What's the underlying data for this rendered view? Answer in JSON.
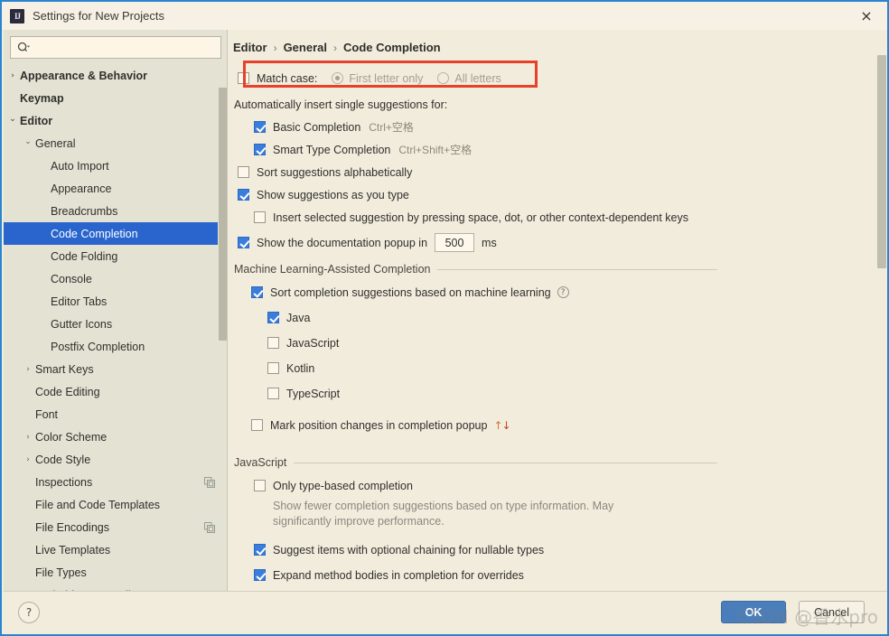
{
  "window": {
    "title": "Settings for New Projects",
    "app_icon": "intellij-idea-icon",
    "close_label": "×"
  },
  "search": {
    "value": "",
    "placeholder": "",
    "icon": "search-icon"
  },
  "sidebar": {
    "items": [
      {
        "label": "Appearance & Behavior",
        "indent": 0,
        "arrow": "›",
        "bold": true,
        "selected": false,
        "trailing_icon": null
      },
      {
        "label": "Keymap",
        "indent": 0,
        "arrow": "",
        "bold": true,
        "selected": false,
        "trailing_icon": null
      },
      {
        "label": "Editor",
        "indent": 0,
        "arrow": "⌄",
        "bold": true,
        "selected": false,
        "trailing_icon": null
      },
      {
        "label": "General",
        "indent": 1,
        "arrow": "⌄",
        "bold": false,
        "selected": false,
        "trailing_icon": null
      },
      {
        "label": "Auto Import",
        "indent": 2,
        "arrow": "",
        "bold": false,
        "selected": false,
        "trailing_icon": null
      },
      {
        "label": "Appearance",
        "indent": 2,
        "arrow": "",
        "bold": false,
        "selected": false,
        "trailing_icon": null
      },
      {
        "label": "Breadcrumbs",
        "indent": 2,
        "arrow": "",
        "bold": false,
        "selected": false,
        "trailing_icon": null
      },
      {
        "label": "Code Completion",
        "indent": 2,
        "arrow": "",
        "bold": false,
        "selected": true,
        "trailing_icon": null
      },
      {
        "label": "Code Folding",
        "indent": 2,
        "arrow": "",
        "bold": false,
        "selected": false,
        "trailing_icon": null
      },
      {
        "label": "Console",
        "indent": 2,
        "arrow": "",
        "bold": false,
        "selected": false,
        "trailing_icon": null
      },
      {
        "label": "Editor Tabs",
        "indent": 2,
        "arrow": "",
        "bold": false,
        "selected": false,
        "trailing_icon": null
      },
      {
        "label": "Gutter Icons",
        "indent": 2,
        "arrow": "",
        "bold": false,
        "selected": false,
        "trailing_icon": null
      },
      {
        "label": "Postfix Completion",
        "indent": 2,
        "arrow": "",
        "bold": false,
        "selected": false,
        "trailing_icon": null
      },
      {
        "label": "Smart Keys",
        "indent": 1,
        "arrow": "›",
        "bold": false,
        "selected": false,
        "trailing_icon": null
      },
      {
        "label": "Code Editing",
        "indent": 1,
        "arrow": "",
        "bold": false,
        "selected": false,
        "trailing_icon": null
      },
      {
        "label": "Font",
        "indent": 1,
        "arrow": "",
        "bold": false,
        "selected": false,
        "trailing_icon": null
      },
      {
        "label": "Color Scheme",
        "indent": 1,
        "arrow": "›",
        "bold": false,
        "selected": false,
        "trailing_icon": null
      },
      {
        "label": "Code Style",
        "indent": 1,
        "arrow": "›",
        "bold": false,
        "selected": false,
        "trailing_icon": null
      },
      {
        "label": "Inspections",
        "indent": 1,
        "arrow": "",
        "bold": false,
        "selected": false,
        "trailing_icon": "copy-icon"
      },
      {
        "label": "File and Code Templates",
        "indent": 1,
        "arrow": "",
        "bold": false,
        "selected": false,
        "trailing_icon": null
      },
      {
        "label": "File Encodings",
        "indent": 1,
        "arrow": "",
        "bold": false,
        "selected": false,
        "trailing_icon": "copy-icon"
      },
      {
        "label": "Live Templates",
        "indent": 1,
        "arrow": "",
        "bold": false,
        "selected": false,
        "trailing_icon": null
      },
      {
        "label": "File Types",
        "indent": 1,
        "arrow": "",
        "bold": false,
        "selected": false,
        "trailing_icon": null
      },
      {
        "label": "Android Layout Editor",
        "indent": 1,
        "arrow": "",
        "bold": false,
        "selected": false,
        "trailing_icon": null
      }
    ]
  },
  "breadcrumb": {
    "parts": [
      "Editor",
      "General",
      "Code Completion"
    ],
    "separator": "›"
  },
  "main": {
    "match_case": {
      "checkbox_label": "Match case:",
      "checked": false,
      "options": [
        {
          "label": "First letter only",
          "selected": true
        },
        {
          "label": "All letters",
          "selected": false
        }
      ],
      "disabled": true,
      "highlight_color": "#e8402a"
    },
    "auto_insert_header": "Automatically insert single suggestions for:",
    "auto_insert_items": [
      {
        "label": "Basic Completion",
        "shortcut": "Ctrl+空格",
        "checked": true
      },
      {
        "label": "Smart Type Completion",
        "shortcut": "Ctrl+Shift+空格",
        "checked": true
      }
    ],
    "sort_alphabetically": {
      "label": "Sort suggestions alphabetically",
      "checked": false
    },
    "show_as_you_type": {
      "label": "Show suggestions as you type",
      "checked": true
    },
    "insert_selected": {
      "label": "Insert selected suggestion by pressing space, dot, or other context-dependent keys",
      "checked": false
    },
    "doc_popup": {
      "label_before": "Show the documentation popup in",
      "value": "500",
      "unit": "ms",
      "checked": true
    },
    "ml_section": {
      "title": "Machine Learning-Assisted Completion",
      "sort_ml": {
        "label": "Sort completion suggestions based on machine learning",
        "checked": true,
        "help_icon": "help-icon",
        "help_glyph": "?"
      },
      "languages": [
        {
          "label": "Java",
          "checked": true
        },
        {
          "label": "JavaScript",
          "checked": false
        },
        {
          "label": "Kotlin",
          "checked": false
        },
        {
          "label": "TypeScript",
          "checked": false
        }
      ],
      "mark_position": {
        "label": "Mark position changes in completion popup",
        "checked": false,
        "up_glyph": "↑",
        "down_glyph": "↓"
      }
    },
    "js_section": {
      "title": "JavaScript",
      "only_type_based": {
        "label": "Only type-based completion",
        "checked": false
      },
      "only_type_based_desc": "Show fewer completion suggestions based on type information. May significantly improve performance.",
      "optional_chaining": {
        "label": "Suggest items with optional chaining for nullable types",
        "checked": true
      },
      "expand_method_bodies": {
        "label": "Expand method bodies in completion for overrides",
        "checked": true
      }
    }
  },
  "footer": {
    "help_glyph": "?",
    "ok_label": "OK",
    "cancel_label": "Cancel"
  },
  "watermark": {
    "text": "CSDN @香水pro"
  }
}
